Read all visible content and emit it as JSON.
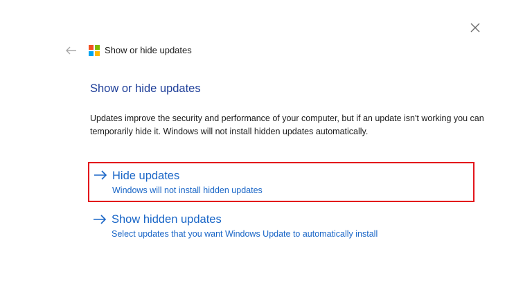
{
  "window": {
    "title": "Show or hide updates"
  },
  "icons": {
    "close": "close-icon",
    "back": "back-arrow-icon",
    "logo": "windows-logo-icon",
    "option": "arrow-right-icon"
  },
  "colors": {
    "heading": "#1f3f99",
    "link": "#1a66c7",
    "highlight_border": "#e3141b",
    "logo_red": "#f25022",
    "logo_green": "#7fba00",
    "logo_blue": "#00a4ef",
    "logo_yellow": "#ffb900"
  },
  "main": {
    "heading": "Show or hide updates",
    "description": "Updates improve the security and performance of your computer, but if an update isn't working you can temporarily hide it. Windows will not install hidden updates automatically.",
    "options": [
      {
        "title": "Hide updates",
        "subtitle": "Windows will not install hidden updates"
      },
      {
        "title": "Show hidden updates",
        "subtitle": "Select updates that you want Windows Update to automatically install"
      }
    ]
  }
}
